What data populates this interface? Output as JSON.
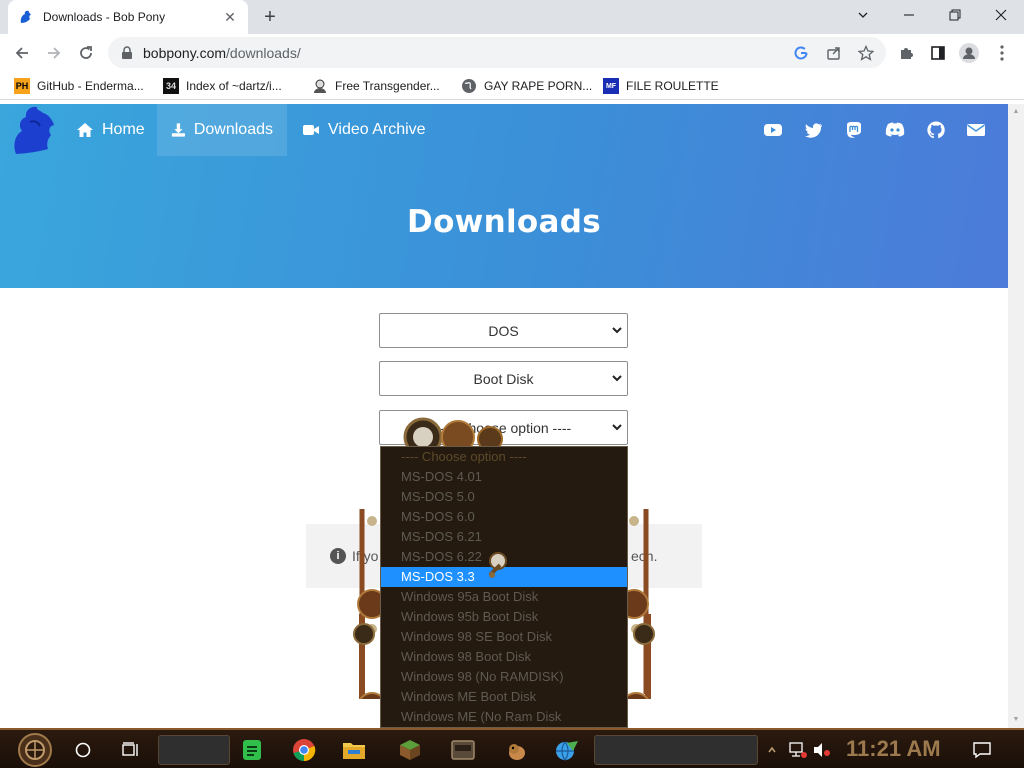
{
  "browser": {
    "tab_title": "Downloads - Bob Pony",
    "url_host": "bobpony.com",
    "url_path": "/downloads/",
    "bookmarks": [
      {
        "label": "GitHub - Enderma...",
        "icon": "github-favicon"
      },
      {
        "label": "Index of ~dartz/i...",
        "icon": "index-favicon"
      },
      {
        "label": "Free Transgender...",
        "icon": "avatar-favicon"
      },
      {
        "label": "GAY RAPE PORN...",
        "icon": "globe-icon"
      },
      {
        "label": "FILE ROULETTE",
        "icon": "file-roulette-favicon"
      }
    ]
  },
  "site": {
    "nav": [
      {
        "label": "Home",
        "icon": "home-icon",
        "active": false
      },
      {
        "label": "Downloads",
        "icon": "download-icon",
        "active": true
      },
      {
        "label": "Video Archive",
        "icon": "video-icon",
        "active": false
      }
    ],
    "social": [
      "youtube-icon",
      "twitter-icon",
      "mastodon-icon",
      "discord-icon",
      "github-icon",
      "email-icon"
    ],
    "hero_title": "Downloads",
    "hero_gradient": [
      "#3aa6dc",
      "#4c7bd9"
    ]
  },
  "form": {
    "os_select": "DOS",
    "type_select": "Boot Disk",
    "version_select": "---- Choose option ----",
    "version_options": [
      "---- Choose option ----",
      "MS-DOS 4.01",
      "MS-DOS 5.0",
      "MS-DOS 6.0",
      "MS-DOS 6.21",
      "MS-DOS 6.22",
      "MS-DOS 3.3",
      "Windows 95a Boot Disk",
      "Windows 95b Boot Disk",
      "Windows 98 SE Boot Disk",
      "Windows 98 Boot Disk",
      "Windows 98 (No RAMDISK)",
      "Windows ME Boot Disk",
      "Windows ME (No Ram Disk"
    ],
    "highlighted_option": "MS-DOS 3.3",
    "highlight_color": "#1e90ff"
  },
  "info": {
    "text_start": "If yo",
    "text_end": "ech."
  },
  "taskbar": {
    "clock": "11:21 AM",
    "apps": [
      "cortana-circle-icon",
      "task-view-icon",
      "spotify-icon",
      "chrome-icon",
      "file-explorer-icon",
      "minecraft-icon",
      "game-icon",
      "pony-icon",
      "network-app-icon"
    ]
  }
}
